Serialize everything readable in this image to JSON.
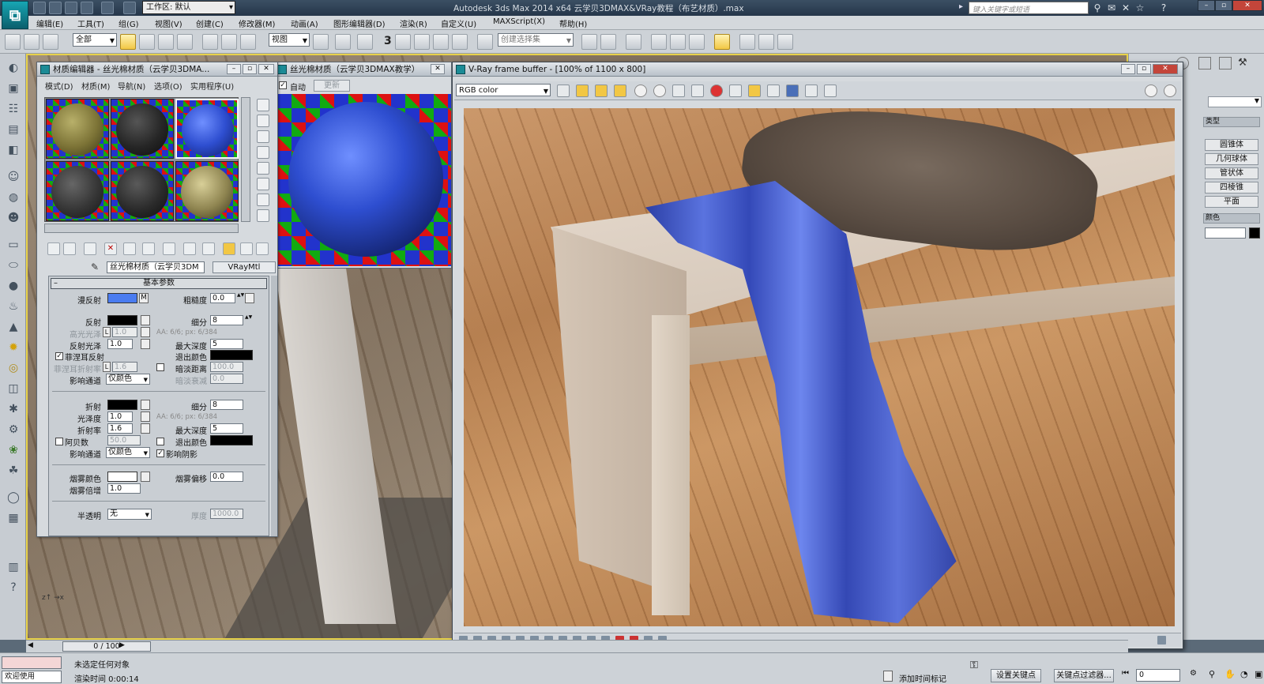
{
  "titlebar": {
    "workspace_label": "工作区: 默认",
    "app_title": "Autodesk 3ds Max  2014 x64     云学贝3DMAX&VRay教程（布艺材质）.max",
    "search_placeholder": "键入关键字或短语"
  },
  "menu": [
    "编辑(E)",
    "工具(T)",
    "组(G)",
    "视图(V)",
    "创建(C)",
    "修改器(M)",
    "动画(A)",
    "图形编辑器(D)",
    "渲染(R)",
    "自定义(U)",
    "MAXScript(X)",
    "帮助(H)"
  ],
  "toolbar": {
    "filter_label": "全部",
    "ref_coord_label": "视图",
    "selection_set_placeholder": "创建选择集",
    "snap_label": "3"
  },
  "material_editor": {
    "title": "材质编辑器 - 丝光棉材质（云学贝3DMA...",
    "menus": [
      "模式(D)",
      "材质(M)",
      "导航(N)",
      "选项(O)",
      "实用程序(U)"
    ],
    "material_name": "丝光棉材质（云学贝3DM",
    "material_type": "VRayMtl",
    "rollout_title": "基本参数",
    "diffuse_label": "漫反射",
    "diffuse_map": "M",
    "diffuse_color": "#4a7cf0",
    "roughness_label": "粗糙度",
    "roughness_value": "0.0",
    "reflect_label": "反射",
    "reflect_subdivs_label": "细分",
    "reflect_subdivs_value": "8",
    "hilight_gloss_label": "高光光泽",
    "hilight_gloss_lock": "L",
    "hilight_gloss_value": "1.0",
    "aa_note": "AA: 6/6; px: 6/384",
    "refl_gloss_label": "反射光泽",
    "refl_gloss_value": "1.0",
    "max_depth_label": "最大深度",
    "max_depth_value": "5",
    "fresnel_label": "菲涅耳反射",
    "fresnel_checked": "✓",
    "exit_color_label": "退出颜色",
    "fresnel_ior_label": "菲涅耳折射率",
    "fresnel_ior_lock": "L",
    "fresnel_ior_value": "1.6",
    "dim_distance_label": "暗淡距离",
    "dim_distance_value": "100.0",
    "affect_channels_label": "影响通道",
    "affect_channels_value": "仅颜色",
    "dim_falloff_label": "暗淡衰减",
    "dim_falloff_value": "0.0",
    "refract_label": "折射",
    "refract_subdivs_label": "细分",
    "refract_subdivs_value": "8",
    "refract_gloss_label": "光泽度",
    "refract_gloss_value": "1.0",
    "refract_aa_note": "AA: 6/6; px: 6/384",
    "ior_label": "折射率",
    "ior_value": "1.6",
    "refract_max_depth_label": "最大深度",
    "refract_max_depth_value": "5",
    "abbe_label": "阿贝数",
    "abbe_value": "50.0",
    "refract_exit_color_label": "退出颜色",
    "refract_affect_label": "影响通道",
    "refract_affect_value": "仅颜色",
    "affect_shadows_label": "影响阴影",
    "affect_shadows_checked": "✓",
    "fog_color_label": "烟雾颜色",
    "fog_bias_label": "烟雾偏移",
    "fog_bias_value": "0.0",
    "fog_mult_label": "烟雾倍增",
    "fog_mult_value": "1.0",
    "translucency_label": "半透明",
    "translucency_value": "无",
    "thickness_label": "厚度",
    "thickness_value": "1000.0"
  },
  "preview_window": {
    "title": "丝光棉材质（云学贝3DMAX教学）",
    "auto_label": "自动",
    "auto_checked": "✓",
    "update_label": "更新"
  },
  "vfb": {
    "title": "V-Ray frame buffer - [100% of 1100 x 800]",
    "channel_label": "RGB color"
  },
  "command_panel": {
    "header_type": "类型",
    "objects": [
      "圆锥体",
      "几何球体",
      "管状体",
      "四棱锥",
      "平面"
    ],
    "header_color": "颜色"
  },
  "timeslider": {
    "frame_label": "0 / 100"
  },
  "statusbar": {
    "welcome_label": "欢迎使用 MAXSc",
    "selection_status": "未选定任何对象",
    "render_time": "渲染时间  0:00:14",
    "add_time_tag": "添加时间标记",
    "set_key_label": "设置关键点",
    "key_filters_label": "关键点过滤器...",
    "frame_value": "0"
  }
}
